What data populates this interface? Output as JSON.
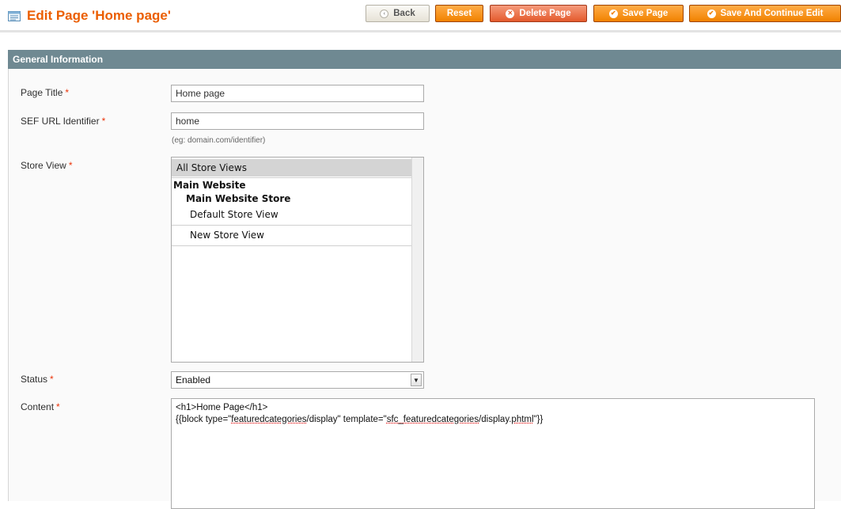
{
  "header": {
    "title": "Edit Page 'Home page'",
    "icon": "page-edit-icon",
    "buttons": {
      "back": "Back",
      "reset": "Reset",
      "delete": "Delete Page",
      "save": "Save Page",
      "save_continue": "Save And Continue Edit"
    }
  },
  "section": {
    "title": "General Information"
  },
  "form": {
    "required_marker": "*",
    "page_title": {
      "label": "Page Title",
      "value": "Home page"
    },
    "identifier": {
      "label": "SEF URL Identifier",
      "value": "home",
      "note": "(eg: domain.com/identifier)"
    },
    "store_view": {
      "label": "Store View",
      "options": [
        "All Store Views",
        "Main Website",
        "Main Website Store",
        "Default Store View",
        "New Store View"
      ],
      "selected": "All Store Views"
    },
    "status": {
      "label": "Status",
      "value": "Enabled"
    },
    "content": {
      "label": "Content",
      "line1": "<h1>Home Page</h1>",
      "line2_a": "{{block type=\"",
      "line2_b": "featuredcategories",
      "line2_c": "/display\" template=\"",
      "line2_d": "sfc_featuredcategories",
      "line2_e": "/display.",
      "line2_f": "phtml",
      "line2_g": "\"}}"
    }
  },
  "colors": {
    "accent": "#eb5e00",
    "button": "#f18200",
    "section_header": "#6f8992",
    "required": "#eb340a"
  }
}
